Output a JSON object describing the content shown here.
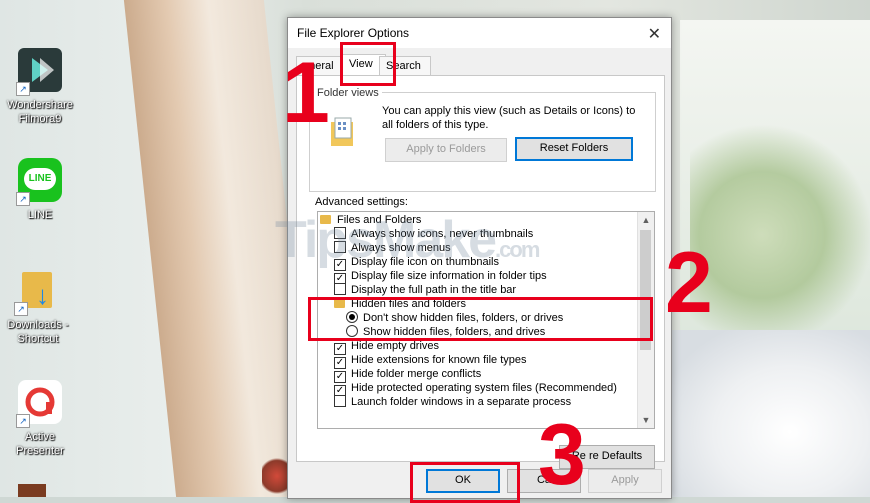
{
  "desktop": {
    "icons": [
      {
        "label_line1": "Wondershare",
        "label_line2": "Filmora9",
        "icon": "filmora-icon"
      },
      {
        "label_line1": "LINE",
        "label_line2": "",
        "icon": "line-app-icon"
      },
      {
        "label_line1": "Downloads -",
        "label_line2": "Shortcut",
        "icon": "downloads-shortcut-icon"
      },
      {
        "label_line1": "Active",
        "label_line2": "Presenter",
        "icon": "active-presenter-icon"
      }
    ],
    "line_tile_text": "LINE"
  },
  "dialog": {
    "title": "File Explorer Options",
    "close_glyph": "✕",
    "tabs": [
      "eneral",
      "View",
      "Search"
    ],
    "folder_views": {
      "group_title": "Folder views",
      "description": "You can apply this view (such as Details or Icons) to all folders of this type.",
      "apply_button": "Apply to Folders",
      "reset_button": "Reset Folders"
    },
    "advanced_label": "Advanced settings:",
    "tree": [
      {
        "type": "folder",
        "label": "Files and Folders"
      },
      {
        "type": "check",
        "checked": false,
        "label": "Always show icons, never thumbnails"
      },
      {
        "type": "check",
        "checked": false,
        "label": "Always show menus"
      },
      {
        "type": "check",
        "checked": true,
        "label": "Display file icon on thumbnails"
      },
      {
        "type": "check",
        "checked": true,
        "label": "Display file size information in folder tips"
      },
      {
        "type": "check",
        "checked": false,
        "label": "Display the full path in the title bar"
      },
      {
        "type": "folder",
        "label": "Hidden files and folders"
      },
      {
        "type": "radio",
        "checked": true,
        "label": "Don't show hidden files, folders, or drives"
      },
      {
        "type": "radio",
        "checked": false,
        "label": "Show hidden files, folders, and drives"
      },
      {
        "type": "check",
        "checked": true,
        "label": "Hide empty drives"
      },
      {
        "type": "check",
        "checked": true,
        "label": "Hide extensions for known file types"
      },
      {
        "type": "check",
        "checked": true,
        "label": "Hide folder merge conflicts"
      },
      {
        "type": "check",
        "checked": true,
        "label": "Hide protected operating system files (Recommended)"
      },
      {
        "type": "check",
        "checked": false,
        "label": "Launch folder windows in a separate process"
      }
    ],
    "restore_button": "Restore Defaults",
    "restore_button_visible": "Re     re Defaults",
    "ok_button": "OK",
    "cancel_button": "Cancel",
    "cancel_button_visible": "Ca",
    "apply_button": "Apply"
  },
  "annotations": [
    "1",
    "2",
    "3"
  ],
  "watermark": {
    "main": "TipsMake",
    "suffix": ".com"
  },
  "colors": {
    "annotation_red": "#e8001c",
    "focus_blue": "#0078d7"
  }
}
